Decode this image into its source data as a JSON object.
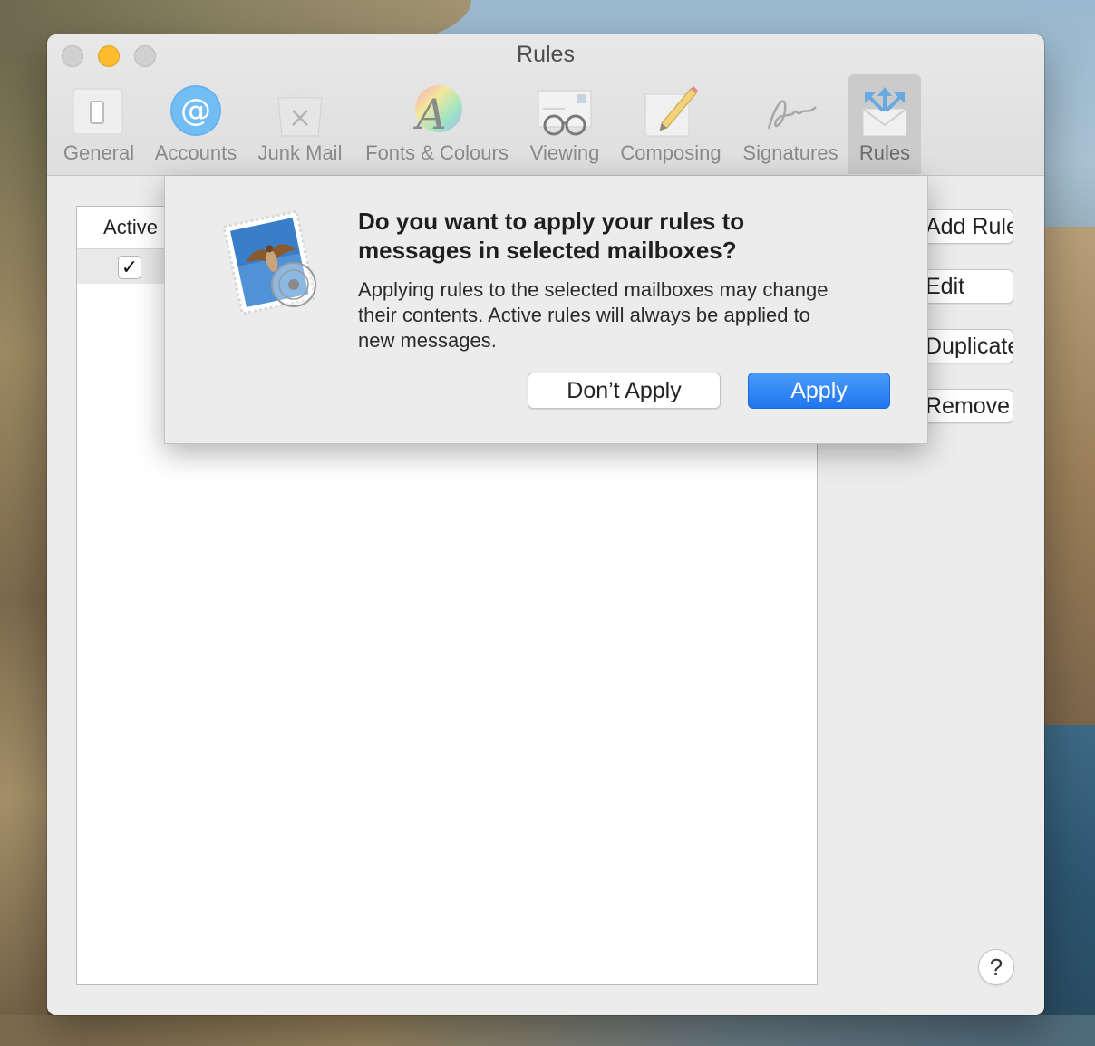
{
  "window": {
    "title": "Rules"
  },
  "toolbar": {
    "items": [
      {
        "label": "General",
        "icon": "general-switch-icon"
      },
      {
        "label": "Accounts",
        "icon": "at-sign-icon"
      },
      {
        "label": "Junk Mail",
        "icon": "trash-bin-icon"
      },
      {
        "label": "Fonts & Colours",
        "icon": "font-colour-icon"
      },
      {
        "label": "Viewing",
        "icon": "glasses-icon"
      },
      {
        "label": "Composing",
        "icon": "pencil-paper-icon"
      },
      {
        "label": "Signatures",
        "icon": "signature-icon"
      },
      {
        "label": "Rules",
        "icon": "rules-envelope-icon"
      }
    ],
    "selected": "Rules"
  },
  "table": {
    "column_active": "Active",
    "rows": [
      {
        "active": true,
        "check_glyph": "✓"
      }
    ]
  },
  "side_buttons": {
    "add_rule": "Add Rule",
    "edit": "Edit",
    "duplicate": "Duplicate",
    "remove": "Remove"
  },
  "help": "?",
  "dialog": {
    "icon": "mail-stamp-icon",
    "title_line1": "Do you want to apply your rules to",
    "title_line2": "messages in selected mailboxes?",
    "body_line1": "Applying rules to the selected mailboxes may change",
    "body_line2": "their contents. Active rules will always be applied to",
    "body_line3": "new messages.",
    "dont_apply": "Don’t Apply",
    "apply": "Apply"
  },
  "colors": {
    "accent": "#1f76ef",
    "minimize": "#fdbc2e"
  }
}
